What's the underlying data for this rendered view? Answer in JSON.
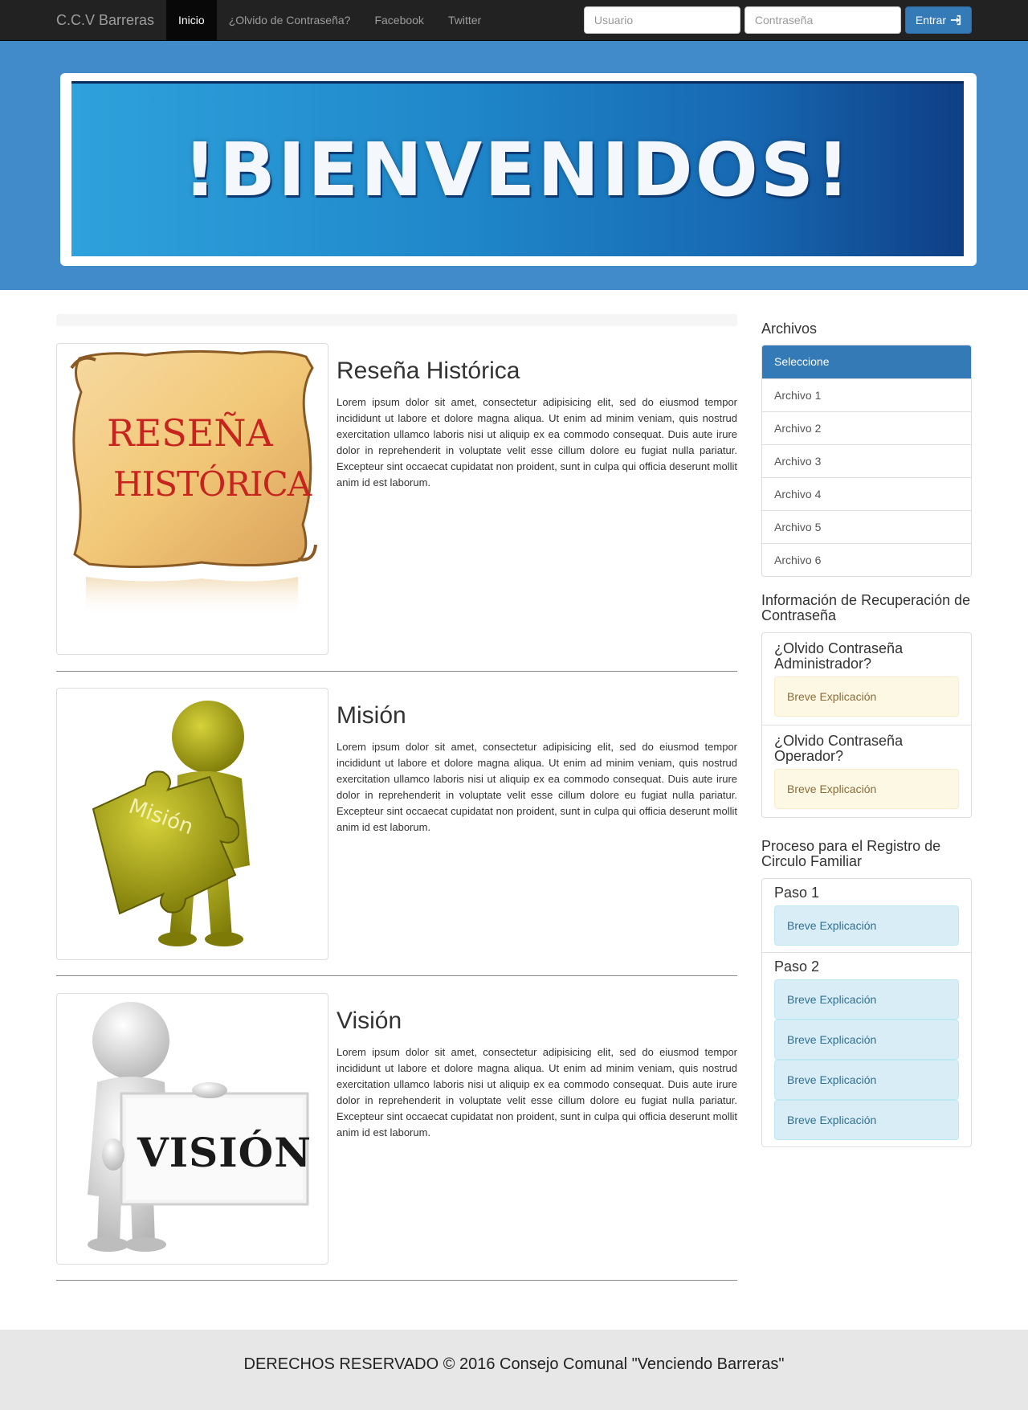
{
  "nav": {
    "brand": "C.C.V Barreras",
    "items": [
      {
        "label": "Inicio",
        "active": true
      },
      {
        "label": "¿Olvido de Contraseña?",
        "active": false
      },
      {
        "label": "Facebook",
        "active": false
      },
      {
        "label": "Twitter",
        "active": false
      }
    ],
    "username_placeholder": "Usuario",
    "password_placeholder": "Contraseña",
    "login_label": "Entrar"
  },
  "banner": {
    "text": "!BIENVENIDOS!"
  },
  "articles": [
    {
      "title": "Reseña Histórica",
      "image_text_1": "RESEÑA",
      "image_text_2": "HISTÓRICA",
      "body": "Lorem ipsum dolor sit amet, consectetur adipisicing elit, sed do eiusmod tempor incididunt ut labore et dolore magna aliqua. Ut enim ad minim veniam, quis nostrud exercitation ullamco laboris nisi ut aliquip ex ea commodo consequat. Duis aute irure dolor in reprehenderit in voluptate velit esse cillum dolore eu fugiat nulla pariatur. Excepteur sint occaecat cupidatat non proident, sunt in culpa qui officia deserunt mollit anim id est laborum."
    },
    {
      "title": "Misión",
      "image_text": "Misión",
      "body": "Lorem ipsum dolor sit amet, consectetur adipisicing elit, sed do eiusmod tempor incididunt ut labore et dolore magna aliqua. Ut enim ad minim veniam, quis nostrud exercitation ullamco laboris nisi ut aliquip ex ea commodo consequat. Duis aute irure dolor in reprehenderit in voluptate velit esse cillum dolore eu fugiat nulla pariatur. Excepteur sint occaecat cupidatat non proident, sunt in culpa qui officia deserunt mollit anim id est laborum."
    },
    {
      "title": "Visión",
      "image_text": "VISIÓN",
      "body": "Lorem ipsum dolor sit amet, consectetur adipisicing elit, sed do eiusmod tempor incididunt ut labore et dolore magna aliqua. Ut enim ad minim veniam, quis nostrud exercitation ullamco laboris nisi ut aliquip ex ea commodo consequat. Duis aute irure dolor in reprehenderit in voluptate velit esse cillum dolore eu fugiat nulla pariatur. Excepteur sint occaecat cupidatat non proident, sunt in culpa qui officia deserunt mollit anim id est laborum."
    }
  ],
  "sidebar": {
    "archivos_title": "Archivos",
    "archivos": [
      "Seleccione",
      "Archivo 1",
      "Archivo 2",
      "Archivo 3",
      "Archivo 4",
      "Archivo 5",
      "Archivo 6"
    ],
    "recovery_title": "Información de Recuperación de Contraseña",
    "recovery": [
      {
        "heading": "¿Olvido Contraseña Administrador?",
        "note": "Breve Explicación"
      },
      {
        "heading": "¿Olvido Contraseña Operador?",
        "note": "Breve Explicación"
      }
    ],
    "registro_title": "Proceso para el Registro de Circulo Familiar",
    "paso1": {
      "heading": "Paso 1",
      "notes": [
        "Breve Explicación"
      ]
    },
    "paso2": {
      "heading": "Paso 2",
      "notes": [
        "Breve Explicación",
        "Breve Explicación",
        "Breve Explicación",
        "Breve Explicación"
      ]
    }
  },
  "footer": {
    "text": "DERECHOS RESERVADO © 2016 Consejo Comunal \"Venciendo Barreras\""
  },
  "colors": {
    "navbar": "#222222",
    "jumbotron": "#428bca",
    "primary": "#337ab7",
    "warning_bg": "#fcf8e3",
    "info_bg": "#d9edf7",
    "footer": "#e7e7e7"
  }
}
